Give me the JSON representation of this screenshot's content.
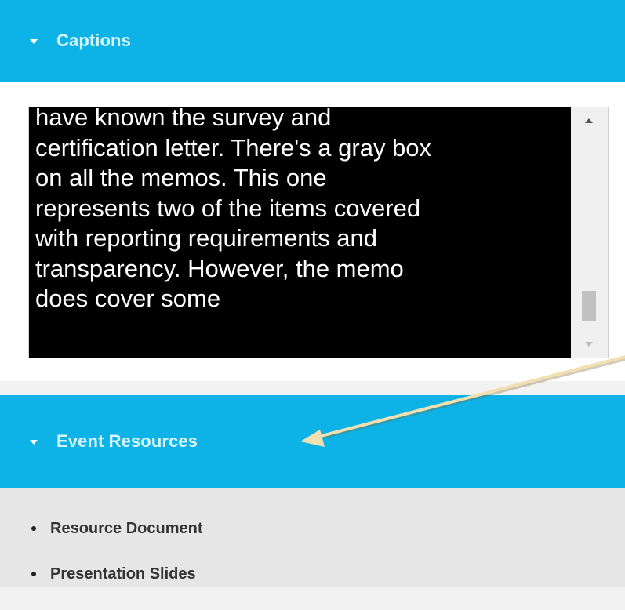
{
  "captions": {
    "title": "Captions",
    "icon": "caret-down-icon",
    "text": "have known the survey and\ncertification letter. There's a gray box\non all the memos. This one\nrepresents two of the items covered\nwith reporting requirements and\ntransparency. However, the memo\ndoes cover some",
    "scroll_position": 0.85
  },
  "event_resources": {
    "title": "Event Resources",
    "icon": "caret-down-icon",
    "items": [
      {
        "label": "Resource Document"
      },
      {
        "label": "Presentation Slides"
      }
    ]
  },
  "annotation": {
    "icon": "arrow-icon",
    "color": "#f2e0b0"
  },
  "colors": {
    "header_bg": "#0db3e6",
    "header_text": "#d8f6ff",
    "caption_bg": "#000000",
    "caption_text": "#ffffff"
  }
}
